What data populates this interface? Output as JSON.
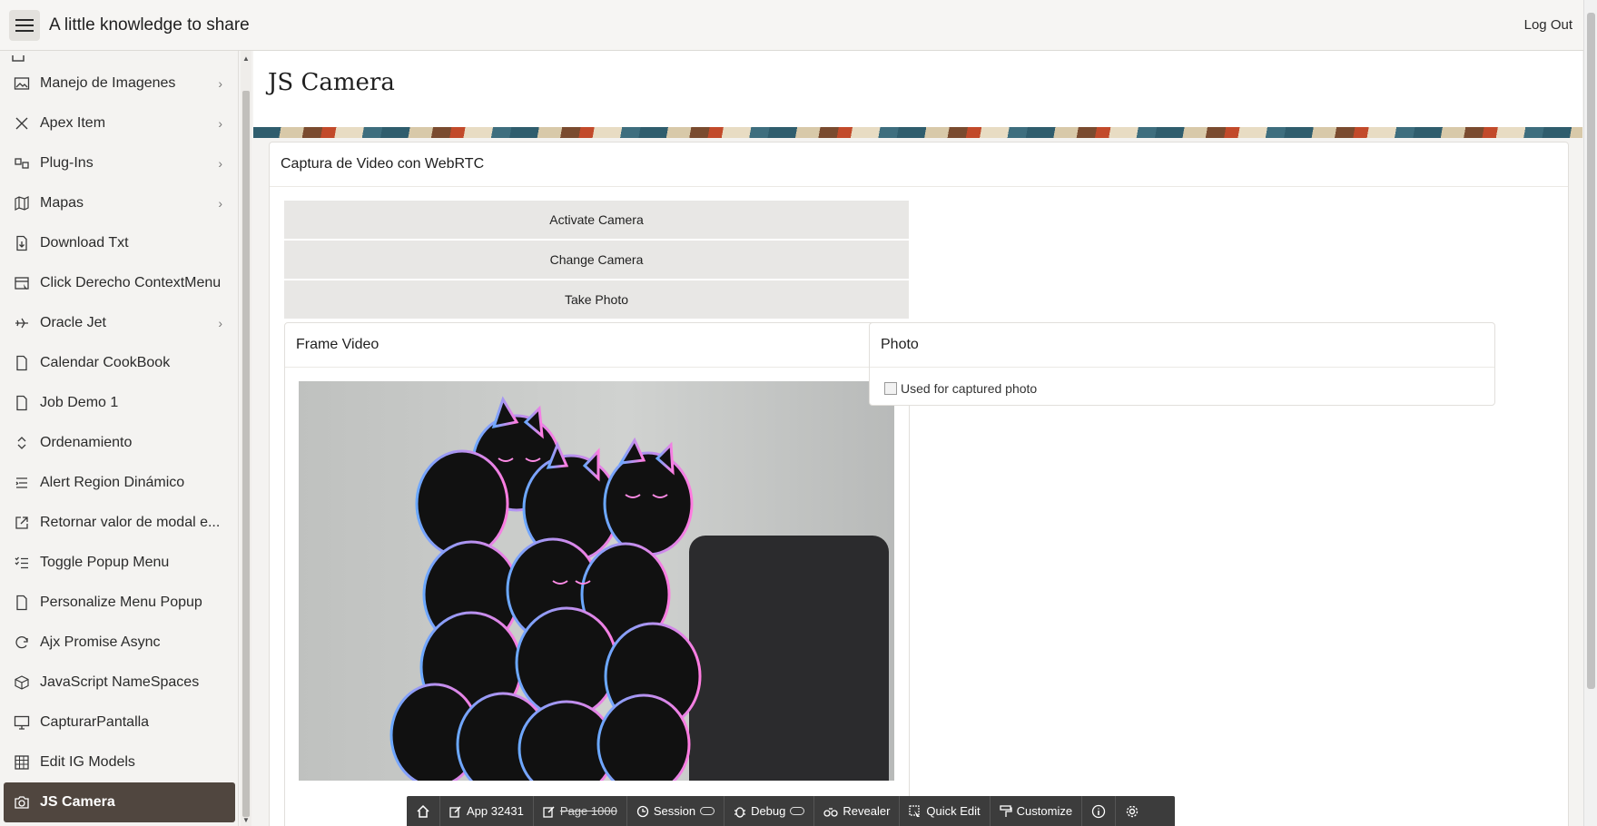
{
  "header": {
    "title": "A little knowledge to share",
    "logout": "Log Out"
  },
  "sidebar": {
    "items": [
      {
        "label": "Manejo de Imagenes",
        "icon": "image-icon",
        "has_children": true
      },
      {
        "label": "Apex Item",
        "icon": "tools-icon",
        "has_children": true
      },
      {
        "label": "Plug-Ins",
        "icon": "plugin-icon",
        "has_children": true
      },
      {
        "label": "Mapas",
        "icon": "map-icon",
        "has_children": true
      },
      {
        "label": "Download Txt",
        "icon": "file-download-icon",
        "has_children": false
      },
      {
        "label": "Click Derecho ContextMenu",
        "icon": "calendar-cursor-icon",
        "has_children": false
      },
      {
        "label": "Oracle Jet",
        "icon": "plane-icon",
        "has_children": true
      },
      {
        "label": "Calendar CookBook",
        "icon": "file-icon",
        "has_children": false
      },
      {
        "label": "Job Demo 1",
        "icon": "file-icon",
        "has_children": false
      },
      {
        "label": "Ordenamiento",
        "icon": "sort-icon",
        "has_children": false
      },
      {
        "label": "Alert Region Dinámico",
        "icon": "list-icon",
        "has_children": false
      },
      {
        "label": "Retornar valor de modal e...",
        "icon": "external-link-icon",
        "has_children": false
      },
      {
        "label": "Toggle Popup Menu",
        "icon": "checklist-icon",
        "has_children": false
      },
      {
        "label": "Personalize Menu Popup",
        "icon": "file-icon",
        "has_children": false
      },
      {
        "label": "Ajx Promise Async",
        "icon": "refresh-icon",
        "has_children": false
      },
      {
        "label": "JavaScript NameSpaces",
        "icon": "cube-icon",
        "has_children": false
      },
      {
        "label": "CapturarPantalla",
        "icon": "monitor-icon",
        "has_children": false
      },
      {
        "label": "Edit IG Models",
        "icon": "grid-icon",
        "has_children": false
      },
      {
        "label": "JS Camera",
        "icon": "camera-icon",
        "has_children": false,
        "active": true
      }
    ]
  },
  "page": {
    "title": "JS Camera",
    "region_title": "Captura de Video con WebRTC",
    "buttons": {
      "activate": "Activate Camera",
      "change": "Change Camera",
      "take": "Take Photo"
    },
    "frame_video": {
      "title": "Frame Video"
    },
    "photo": {
      "title": "Photo",
      "alt_text": "Used for captured photo"
    }
  },
  "devbar": {
    "app": "App 32431",
    "page": "Page 1000",
    "session": "Session",
    "debug": "Debug",
    "revealer": "Revealer",
    "quick_edit": "Quick Edit",
    "customize": "Customize"
  },
  "colors": {
    "active_nav": "#50463f",
    "devbar": "#3c3c3c",
    "button_bg": "#e8e7e5"
  }
}
